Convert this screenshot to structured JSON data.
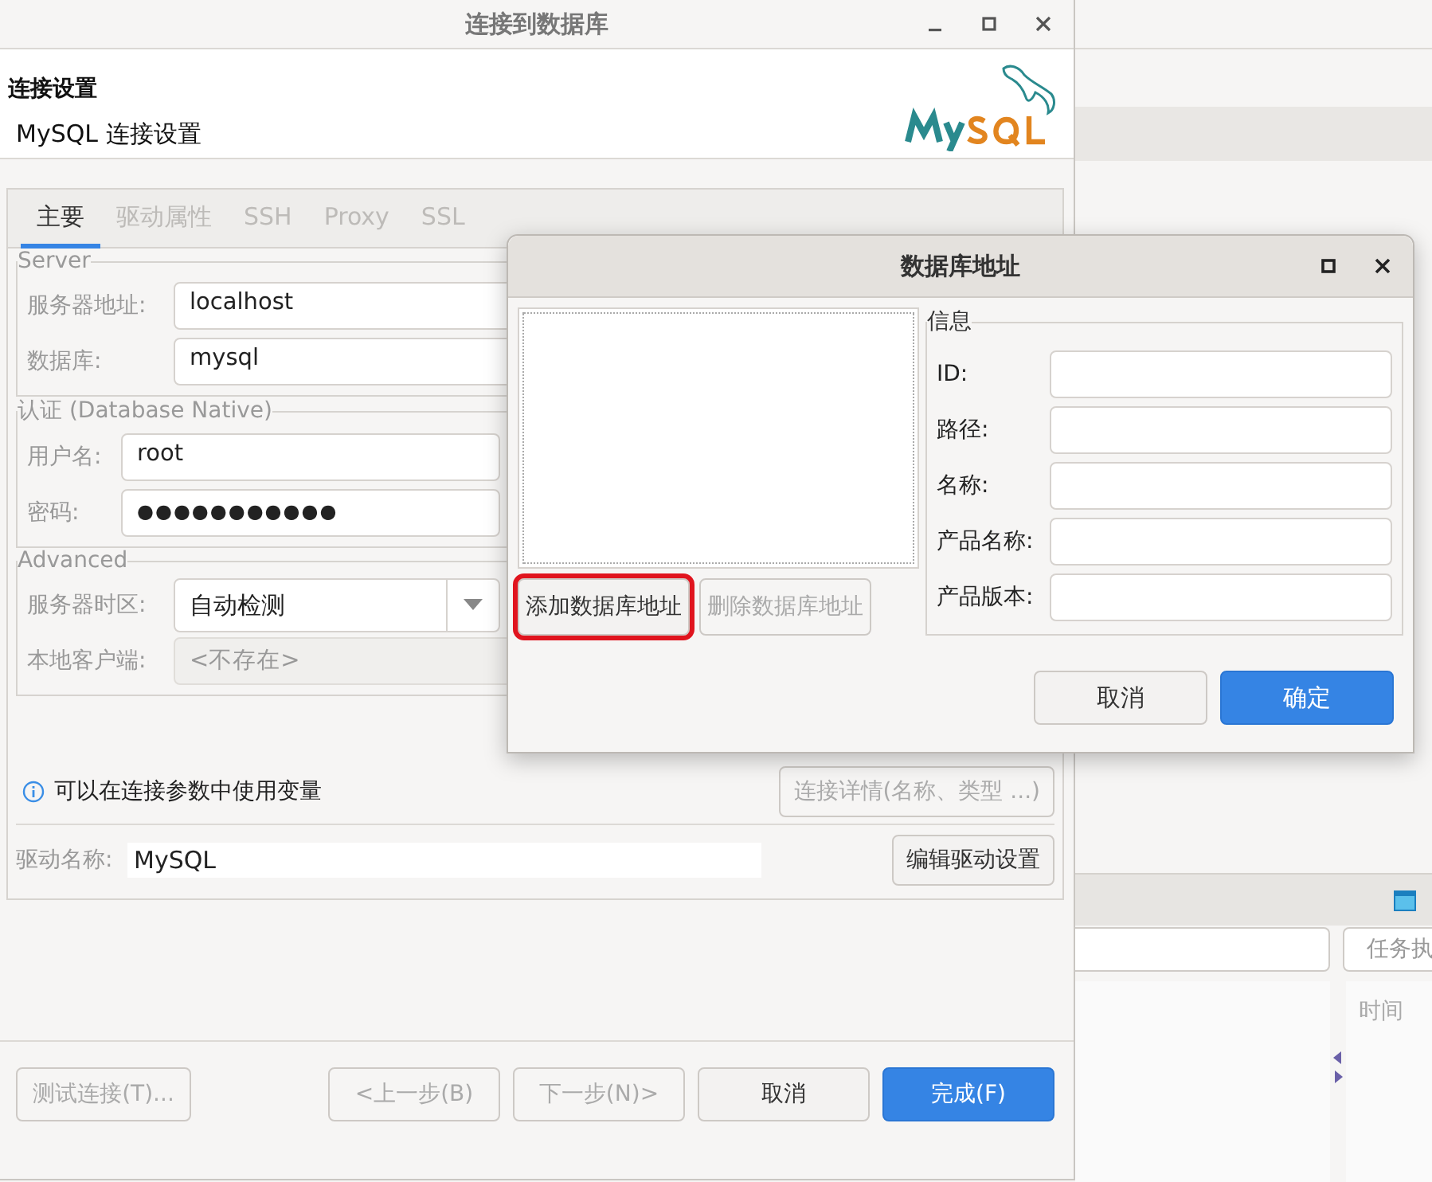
{
  "background_app": {
    "task_field": {
      "placeholder": "任务执"
    },
    "column_header": "时间"
  },
  "main_window": {
    "title": "连接到数据库",
    "header": {
      "title": "连接设置",
      "subtitle": "MySQL 连接设置"
    },
    "tabs": [
      {
        "label": "主要",
        "selected": true
      },
      {
        "label": "驱动属性",
        "selected": false
      },
      {
        "label": "SSH",
        "selected": false
      },
      {
        "label": "Proxy",
        "selected": false
      },
      {
        "label": "SSL",
        "selected": false
      }
    ],
    "sections": [
      {
        "legend": "Server",
        "rows": [
          {
            "kind": "text",
            "label": "服务器地址:",
            "value": "localhost",
            "disabled": false
          },
          {
            "kind": "text",
            "label": "数据库:",
            "value": "mysql",
            "disabled": false
          }
        ]
      },
      {
        "legend": "认证 (Database Native)",
        "rows": [
          {
            "kind": "text",
            "label": "用户名:",
            "value": "root",
            "disabled": false
          },
          {
            "kind": "password",
            "label": "密码:",
            "value": "●●●●●●●●●●●",
            "disabled": false
          }
        ]
      },
      {
        "legend": "Advanced",
        "rows": [
          {
            "kind": "combo",
            "label": "服务器时区:",
            "value": "自动检测",
            "disabled": false
          },
          {
            "kind": "text",
            "label": "本地客户端:",
            "value": "<不存在>",
            "disabled": true
          }
        ]
      }
    ],
    "hint": "可以在连接参数中使用变量",
    "details_button": {
      "label": "连接详情(名称、类型 ...)",
      "disabled": true
    },
    "driver": {
      "label": "驱动名称:",
      "value": "MySQL",
      "button": "编辑驱动设置"
    },
    "footer_buttons": [
      {
        "label": "测试连接(T)...",
        "disabled": true,
        "primary": false
      },
      {
        "label": "<上一步(B)",
        "disabled": true,
        "primary": false
      },
      {
        "label": "下一步(N)>",
        "disabled": true,
        "primary": false
      },
      {
        "label": "取消",
        "disabled": false,
        "primary": false
      },
      {
        "label": "完成(F)",
        "disabled": false,
        "primary": true
      }
    ]
  },
  "address_dialog": {
    "title": "数据库地址",
    "list_buttons": [
      {
        "label": "添加数据库地址",
        "disabled": false,
        "highlighted": true
      },
      {
        "label": "删除数据库地址",
        "disabled": true,
        "highlighted": false
      }
    ],
    "info": {
      "legend": "信息",
      "fields": [
        {
          "label": "ID:"
        },
        {
          "label": "路径:"
        },
        {
          "label": "名称:"
        },
        {
          "label": "产品名称:"
        },
        {
          "label": "产品版本:"
        }
      ]
    },
    "buttons": [
      {
        "label": "取消",
        "primary": false
      },
      {
        "label": "确定",
        "primary": true
      }
    ]
  }
}
